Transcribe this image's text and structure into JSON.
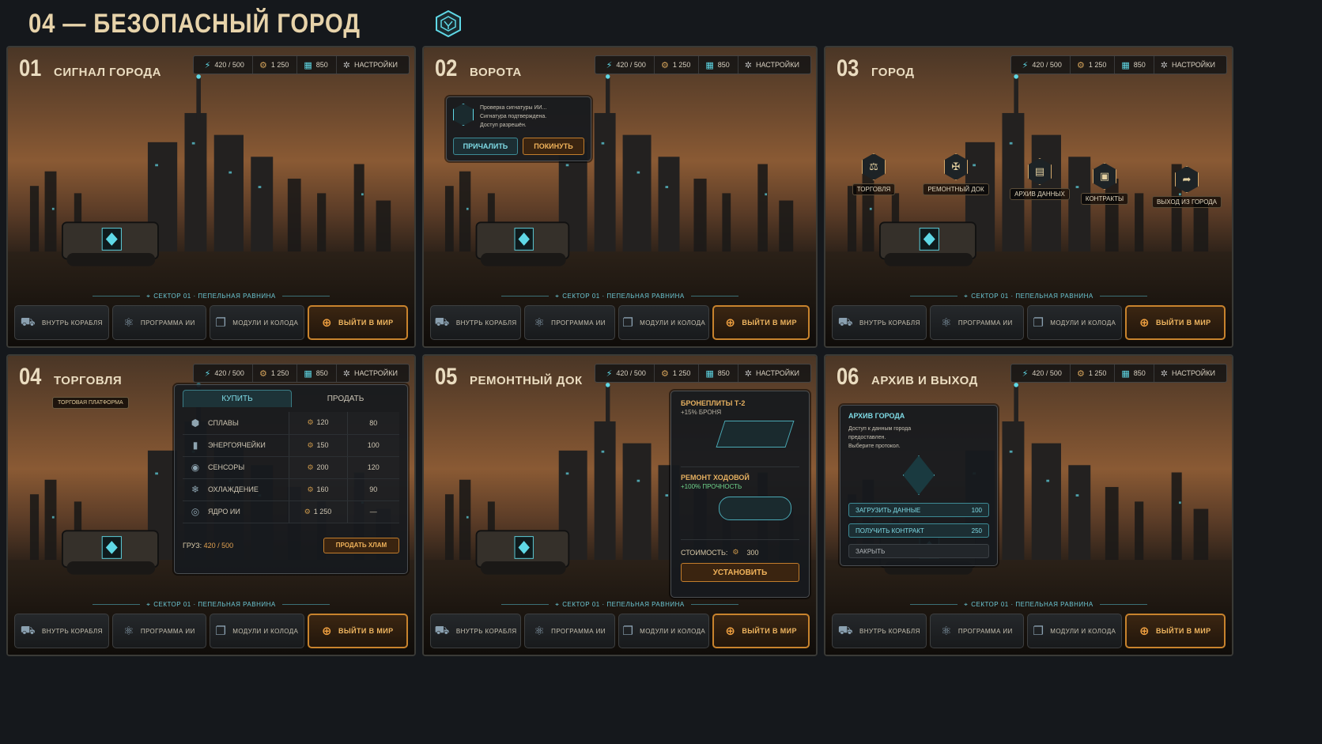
{
  "page": {
    "title": "04 — БЕЗОПАСНЫЙ ГОРОД",
    "logo_icon": "ai-hex-emblem-icon",
    "colors": {
      "accent_teal": "#5fd8e6",
      "accent_amber": "#c8832d",
      "bg": "#15181c"
    }
  },
  "hud": {
    "energy": "420 / 500",
    "credits": "1 250",
    "data": "850",
    "settings": "НАСТРОЙКИ"
  },
  "location": "СЕКТОР 01 · ПЕПЕЛЬНАЯ РАВНИНА",
  "nav": {
    "inside_ship": "ВНУТРЬ КОРАБЛЯ",
    "ai_program": "ПРОГРАММА ИИ",
    "modules_deck": "МОДУЛИ И КОЛОДА",
    "exit_world": "ВЫЙТИ В МИР"
  },
  "panels": [
    {
      "num": "01",
      "title": "СИГНАЛ ГОРОДА"
    },
    {
      "num": "02",
      "title": "ВОРОТА"
    },
    {
      "num": "03",
      "title": "ГОРОД"
    },
    {
      "num": "04",
      "title": "ТОРГОВЛЯ"
    },
    {
      "num": "05",
      "title": "РЕМОНТНЫЙ ДОК"
    },
    {
      "num": "06",
      "title": "АРХИВ И ВЫХОД"
    }
  ],
  "gate_dialog": {
    "lines": [
      "Проверка сигнатуры ИИ...",
      "Сигнатура подтверждена.",
      "Доступ разрешён."
    ],
    "dock_button": "ПРИЧАЛИТЬ",
    "leave_button": "ПОКИНУТЬ"
  },
  "city_locations": [
    "ТОРГОВЛЯ",
    "РЕМОНТНЫЙ ДОК",
    "АРХИВ ДАННЫХ",
    "КОНТРАКТЫ",
    "ВЫХОД ИЗ ГОРОДА"
  ],
  "trade": {
    "platform_label": "ТОРГОВАЯ ПЛАТФОРМА",
    "tab_buy": "КУПИТЬ",
    "tab_sell": "ПРОДАТЬ",
    "items": [
      {
        "name": "СПЛАВЫ",
        "buy": "120",
        "sell": "80"
      },
      {
        "name": "ЭНЕРГОЯЧЕЙКИ",
        "buy": "150",
        "sell": "100"
      },
      {
        "name": "СЕНСОРЫ",
        "buy": "200",
        "sell": "120"
      },
      {
        "name": "ОХЛАЖДЕНИЕ",
        "buy": "160",
        "sell": "90"
      },
      {
        "name": "ЯДРО ИИ",
        "buy": "1 250",
        "sell": "—"
      }
    ],
    "cargo_label": "ГРУЗ:",
    "cargo_value": "420 / 500",
    "sell_junk": "ПРОДАТЬ ХЛАМ"
  },
  "repair": {
    "item1_title": "БРОНЕПЛИТЫ Т-2",
    "item1_sub": "+15% БРОНЯ",
    "item2_title": "РЕМОНТ ХОДОВОЙ",
    "item2_sub": "+100% ПРОЧНОСТЬ",
    "cost_label": "СТОИМОСТЬ:",
    "cost_value": "300",
    "install": "УСТАНОВИТЬ"
  },
  "archive": {
    "title": "АРХИВ ГОРОДА",
    "desc": [
      "Доступ к данным города",
      "предоставлен.",
      "Выберите протокол."
    ],
    "load_data": "ЗАГРУЗИТЬ ДАННЫЕ",
    "load_cost": "100",
    "get_contract": "ПОЛУЧИТЬ КОНТРАКТ",
    "contract_cost": "250",
    "close": "ЗАКРЫТЬ"
  }
}
